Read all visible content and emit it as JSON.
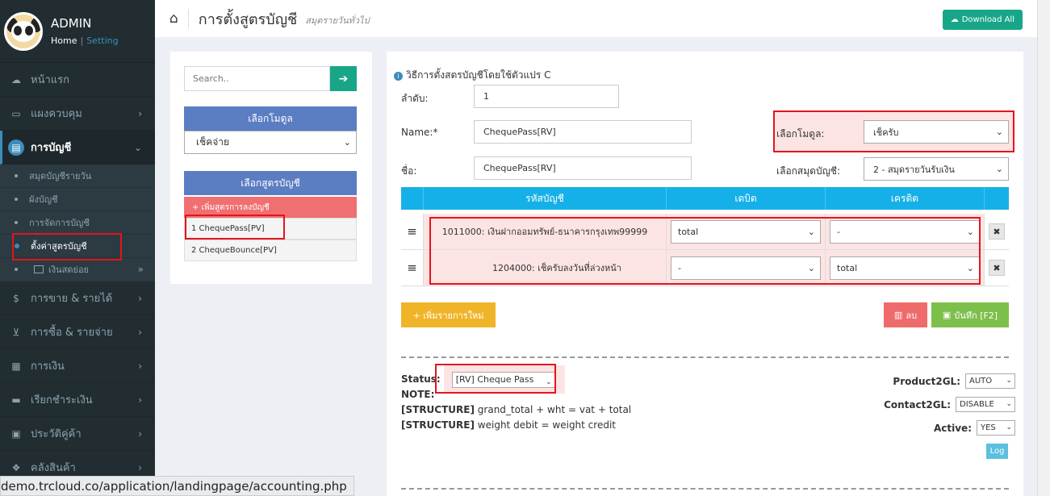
{
  "sidebar": {
    "user": {
      "name": "ADMIN",
      "home": "Home",
      "setting": "Setting"
    },
    "menu": [
      {
        "label": "หน้าแรก",
        "icon": "cloud-icon"
      },
      {
        "label": "แผงควบคุม",
        "icon": "monitor-icon"
      },
      {
        "label": "การบัญชี",
        "icon": "book-icon"
      }
    ],
    "submenu": [
      {
        "label": "สมุดบัญชีรายวัน"
      },
      {
        "label": "ผังบัญชี"
      },
      {
        "label": "การจัดการบัญชี"
      },
      {
        "label": "ตั้งค่าสูตรบัญชี"
      },
      {
        "label": "เงินสดย่อย"
      }
    ],
    "menu2": [
      {
        "label": "การขาย & รายได้",
        "icon": "dollar-icon"
      },
      {
        "label": "การซื้อ & รายจ่าย",
        "icon": "cart-icon"
      },
      {
        "label": "การเงิน",
        "icon": "calendar-icon"
      },
      {
        "label": "เรียกชำระเงิน",
        "icon": "card-icon"
      },
      {
        "label": "ประวัติคู่ค้า",
        "icon": "contact-icon"
      },
      {
        "label": "คลังสินค้า",
        "icon": "cubes-icon"
      }
    ]
  },
  "header": {
    "title": "การตั้งสูตรบัญชี",
    "subtitle": "สมุดรายวันทั่วไป",
    "download": "Download All"
  },
  "left": {
    "search_placeholder": "Search..",
    "module_head": "เลือกโมดูล",
    "module_value": "เช็คจ่าย",
    "formula_head": "เลือกสูตรบัญชี",
    "add_formula": "+ เพิ่มสูตรการลงบัญชี",
    "formulas": [
      "1 ChequePass[PV]",
      "2 ChequeBounce[PV]"
    ]
  },
  "main": {
    "info": "วิธีการตั้งสตรบัญชีโดยใช้ตัวแปร C",
    "order_label": "ลำดับ:",
    "order_value": "1",
    "name_label": "Name:*",
    "name_value": "ChequePass[RV]",
    "name_th_label": "ชื่อ:",
    "name_th_value": "ChequePass[RV]",
    "module_label": "เลือกโมดูล:",
    "module_value": "เช็ครับ",
    "journal_label": "เลือกสมุดบัญชี:",
    "journal_value": "2 - สมุดรายวันรับเงิน",
    "table_head": {
      "account": "รหัสบัญชี",
      "debit": "เดบิต",
      "credit": "เครดิต"
    },
    "rows": [
      {
        "account": "1011000: เงินฝากออมทรัพย์-ธนาคารกรุงเทพ99999",
        "debit": "total",
        "credit": "-"
      },
      {
        "account": "1204000: เช็ครับลงวันที่ล่วงหน้า",
        "debit": "-",
        "credit": "total"
      }
    ],
    "add_row": "+ เพิ่มรายการใหม่",
    "delete": "ลบ",
    "save": "บันทึก [F2]",
    "status_label": "Status:",
    "status_value": "[RV] Cheque Pass",
    "note_label": "NOTE:",
    "structure1_tag": "[STRUCTURE]",
    "structure1": "grand_total + wht = vat + total",
    "structure2_tag": "[STRUCTURE]",
    "structure2": "weight debit = weight credit",
    "product2gl_label": "Product2GL:",
    "product2gl_value": "AUTO",
    "contact2gl_label": "Contact2GL:",
    "contact2gl_value": "DISABLE",
    "active_label": "Active:",
    "active_value": "YES",
    "log": "Log"
  },
  "status_url": "demo.trcloud.co/application/landingpage/accounting.php"
}
